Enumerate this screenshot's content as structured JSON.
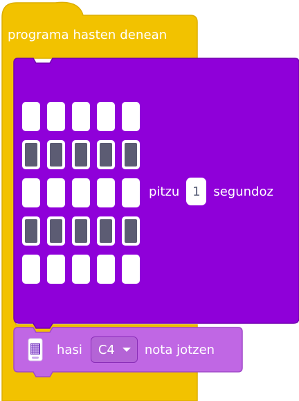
{
  "event_block": {
    "label": "programa hasten denean",
    "color": "#f2c200"
  },
  "led_block": {
    "color": "#8f00d9",
    "grid": [
      [
        0,
        0,
        0,
        0,
        0
      ],
      [
        1,
        1,
        1,
        1,
        1
      ],
      [
        0,
        0,
        0,
        0,
        0
      ],
      [
        1,
        1,
        1,
        1,
        1
      ],
      [
        0,
        0,
        0,
        0,
        0
      ]
    ],
    "prefix": "pitzu",
    "seconds_value": "1",
    "suffix": "segundoz"
  },
  "music_block": {
    "color": "#c067e4",
    "icon": "microbit-icon",
    "prefix": "hasi",
    "note": "C4",
    "suffix": "nota jotzen"
  }
}
